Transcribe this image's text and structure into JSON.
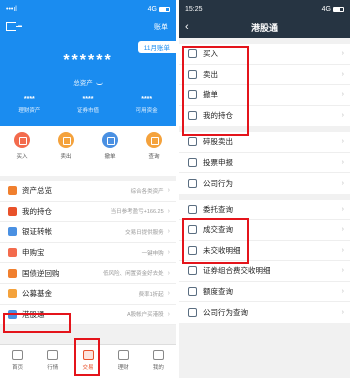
{
  "left": {
    "status": {
      "signal": "•••ıl",
      "time": "",
      "network": "4G"
    },
    "header": {
      "dash": "–",
      "bill_label": "账单",
      "month_tag": "11月账单",
      "masked_total": "******",
      "total_label": "总资产"
    },
    "asset_summary": [
      {
        "value": "****",
        "label": "理财资产"
      },
      {
        "value": "****",
        "label": "证券市值"
      },
      {
        "value": "****",
        "label": "可用资金"
      }
    ],
    "quick_actions": [
      {
        "label": "买入",
        "icon": "buy-icon",
        "color": "#f36b4d"
      },
      {
        "label": "卖出",
        "icon": "sell-icon",
        "color": "#f4a23c"
      },
      {
        "label": "撤单",
        "icon": "cancel-order-icon",
        "color": "#4a90e2"
      },
      {
        "label": "查询",
        "icon": "query-icon",
        "color": "#f4a23c"
      }
    ],
    "menu": [
      {
        "label": "资产总览",
        "hint": "综合各类资产",
        "icon_color": "#f07f2e"
      },
      {
        "label": "我的持仓",
        "hint": "当日参考盈亏+166.25",
        "icon_color": "#e8512a"
      },
      {
        "label": "银证转帐",
        "hint": "交易日提供服务",
        "icon_color": "#4a90e2"
      },
      {
        "label": "申购宝",
        "hint": "一键申购",
        "icon_color": "#f36b4d"
      },
      {
        "label": "国债逆回购",
        "hint": "低风险、闲置资金好去处",
        "icon_color": "#f07f2e"
      },
      {
        "label": "公募基金",
        "hint": "费率1折起",
        "icon_color": "#f4a23c"
      },
      {
        "label": "港股通",
        "hint": "A股帐户买港股",
        "icon_color": "#4a90e2"
      }
    ],
    "tabs": [
      {
        "label": "首页",
        "active": false
      },
      {
        "label": "行情",
        "active": false
      },
      {
        "label": "交易",
        "active": true
      },
      {
        "label": "理财",
        "active": false
      },
      {
        "label": "我的",
        "active": false
      }
    ]
  },
  "right": {
    "status": {
      "time": "15:25",
      "network": "4G"
    },
    "title": "港股通",
    "groups": [
      [
        "买入",
        "卖出",
        "撤单",
        "我的持仓"
      ],
      [
        "碎股卖出",
        "投票申报",
        "公司行为"
      ],
      [
        "委托查询",
        "成交查询",
        "未交收明细",
        "证券组合费交收明细",
        "额度查询",
        "公司行为查询"
      ]
    ]
  },
  "colors": {
    "brand_blue": "#1a8cf0",
    "dark_nav": "#263442",
    "highlight_red": "#e4141b",
    "active_orange": "#e8512a"
  }
}
